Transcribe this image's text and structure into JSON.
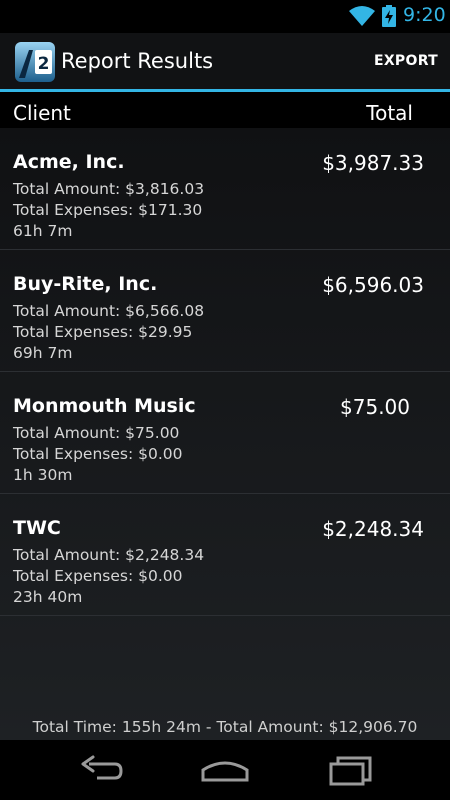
{
  "status_bar": {
    "time": "9:20",
    "icons": [
      "wifi-icon",
      "battery-charging-icon"
    ],
    "accent_color": "#33b5e5"
  },
  "action_bar": {
    "title": "Report Results",
    "export_label": "EXPORT",
    "app_icon": "app-logo-icon"
  },
  "columns": {
    "client": "Client",
    "total": "Total"
  },
  "rows": [
    {
      "name": "Acme, Inc.",
      "total": "$3,987.33",
      "amount": "Total Amount: $3,816.03",
      "expenses": "Total Expenses: $171.30",
      "time": "61h 7m"
    },
    {
      "name": "Buy-Rite, Inc.",
      "total": "$6,596.03",
      "amount": "Total Amount: $6,566.08",
      "expenses": "Total Expenses: $29.95",
      "time": "69h 7m"
    },
    {
      "name": "Monmouth Music",
      "total": "$75.00",
      "amount": "Total Amount: $75.00",
      "expenses": "Total Expenses: $0.00",
      "time": "1h 30m"
    },
    {
      "name": "TWC",
      "total": "$2,248.34",
      "amount": "Total Amount: $2,248.34",
      "expenses": "Total Expenses: $0.00",
      "time": "23h 40m"
    }
  ],
  "summary": "Total Time: 155h 24m - Total Amount: $12,906.70",
  "nav_bar": {
    "icons": [
      "back-icon",
      "home-icon",
      "recent-apps-icon"
    ]
  }
}
